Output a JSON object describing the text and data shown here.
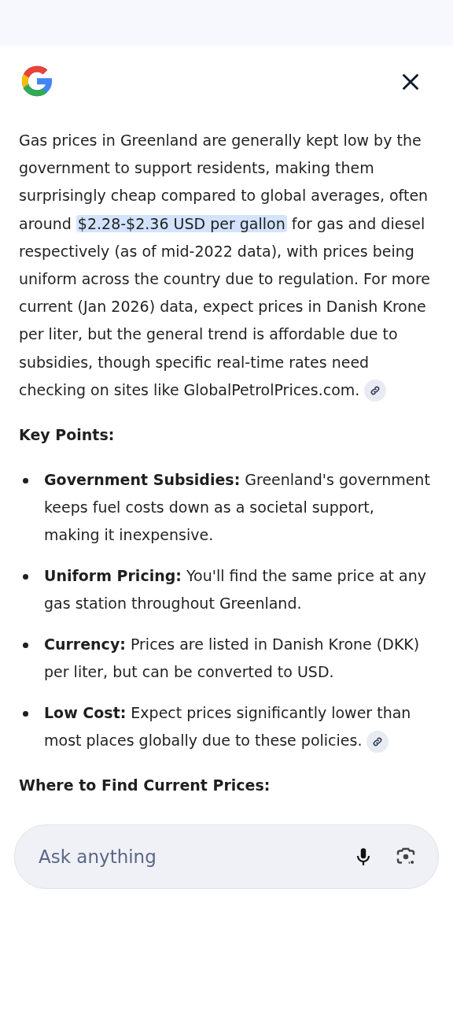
{
  "summary": {
    "before": "Gas prices in Greenland are generally kept low by the government to support residents, making them surprisingly cheap compared to global averages, often around ",
    "highlight": "$2.28-$2.36 USD per gallon",
    "after": " for gas and diesel respectively (as of mid-2022 data), with prices being uniform across the country due to regulation. For more current (Jan 2026) data, expect prices in Danish Krone per liter, but the general trend is affordable due to subsidies, though specific real-time rates need checking on sites like GlobalPetrolPrices.com."
  },
  "key_points_heading": "Key Points:",
  "key_points": [
    {
      "text": "**Government Subsidies:** Greenland's government keeps fuel costs down as a societal support, making it inexpensive.",
      "citation": false
    },
    {
      "text": "**Uniform Pricing:** You'll find the same price at any gas station throughout Greenland.",
      "citation": false
    },
    {
      "text": "**Currency:** Prices are listed in Danish Krone (DKK) per liter, but can be converted to USD.",
      "citation": false
    },
    {
      "text": "**Low Cost:** Expect prices significantly lower than most places globally due to these policies.",
      "citation": true
    }
  ],
  "next_heading": "Where to Find Current Prices:",
  "search": {
    "placeholder": "Ask anything"
  }
}
